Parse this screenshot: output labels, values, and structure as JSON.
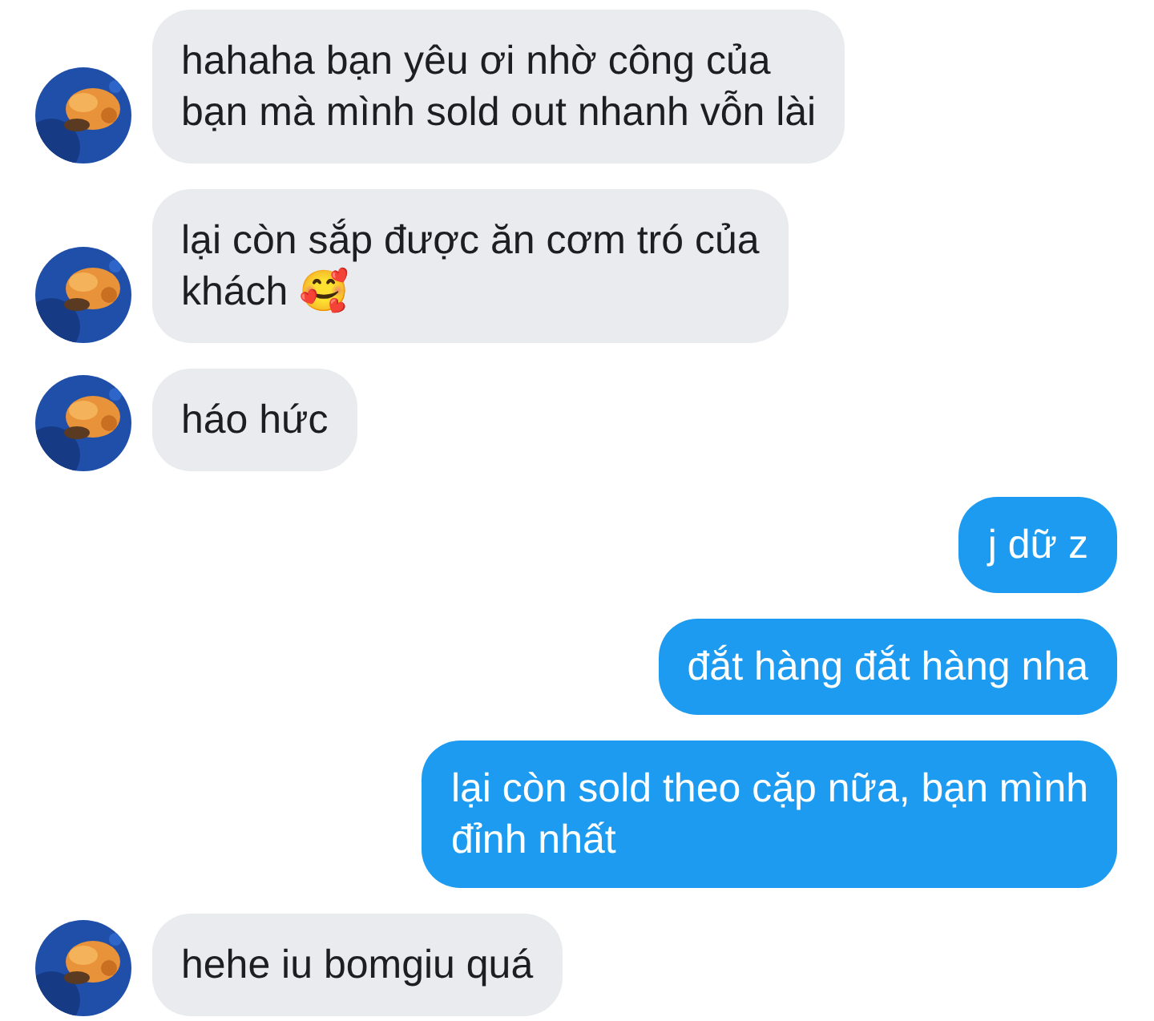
{
  "messages": [
    {
      "kind": "incoming",
      "text": "hahaha bạn yêu ơi nhờ công của\nbạn mà mình sold out nhanh vỗn lài"
    },
    {
      "kind": "incoming",
      "text": "lại còn sắp được ăn cơm tró của\nkhách 🥰"
    },
    {
      "kind": "incoming",
      "text": "háo hức"
    },
    {
      "kind": "outgoing",
      "text": "j dữ z"
    },
    {
      "kind": "outgoing",
      "text": "đắt hàng đắt hàng nha"
    },
    {
      "kind": "outgoing",
      "text": "lại còn sold theo cặp nữa, bạn mình\nđỉnh nhất"
    },
    {
      "kind": "incoming",
      "text": "hehe iu bomgiu quá"
    }
  ]
}
